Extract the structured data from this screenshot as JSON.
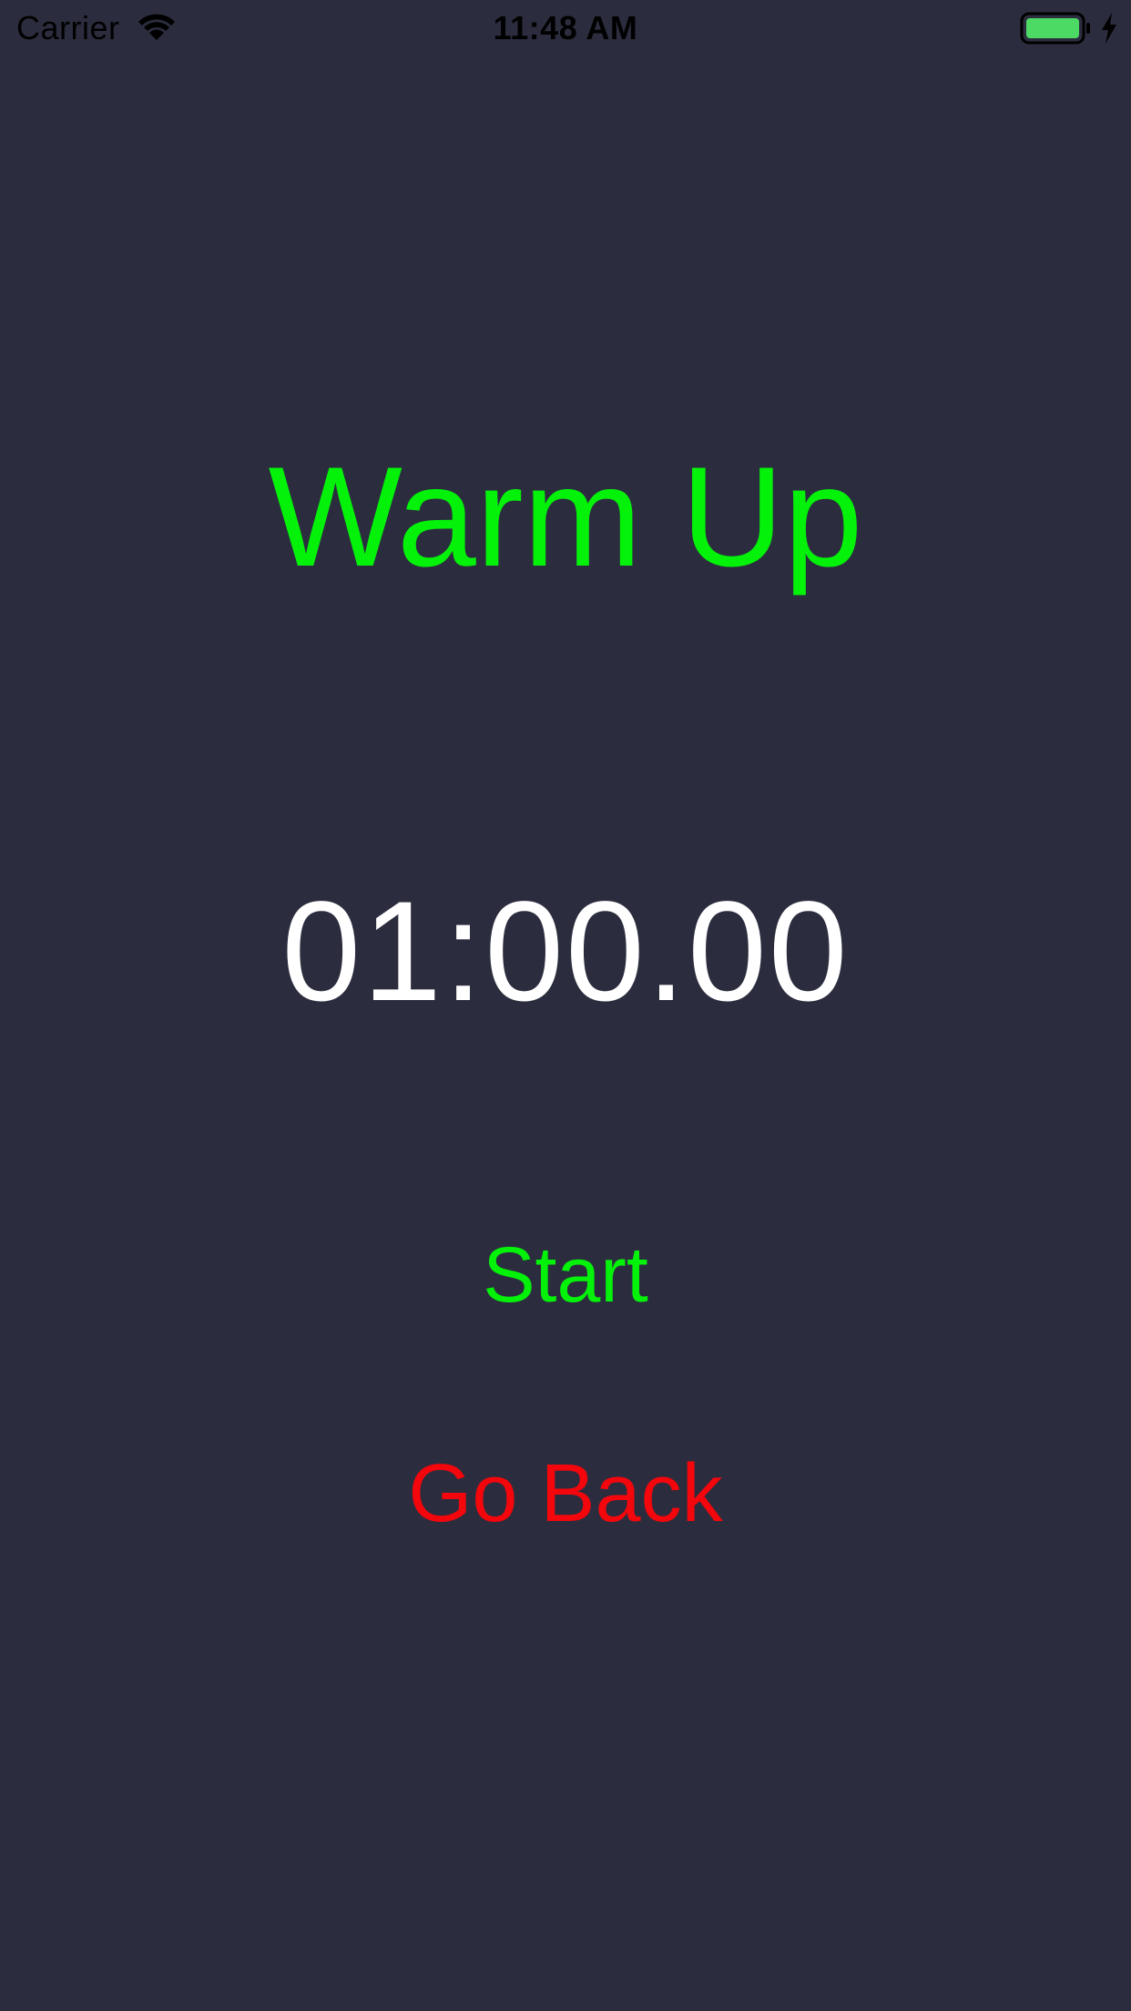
{
  "status_bar": {
    "carrier": "Carrier",
    "time": "11:48 AM",
    "wifi_icon": "wifi-icon",
    "battery_icon": "battery-icon",
    "charging_icon": "bolt-icon",
    "battery_level": 1.0
  },
  "screen": {
    "title": "Warm Up",
    "timer": "01:00.00",
    "start_label": "Start",
    "back_label": "Go Back"
  },
  "colors": {
    "background": "#2b2d3e",
    "title": "#04f20a",
    "timer": "#ffffff",
    "start": "#04f20a",
    "back": "#f3060c",
    "battery_fill": "#4cd964"
  }
}
